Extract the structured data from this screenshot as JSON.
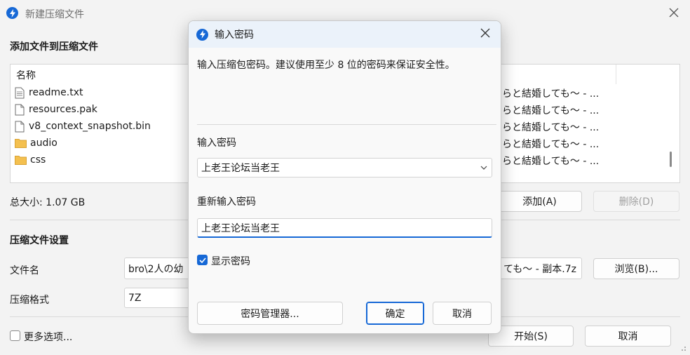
{
  "main_window": {
    "title": "新建压缩文件",
    "add_section_title": "添加文件到压缩文件",
    "file_list": {
      "header": "名称",
      "items": [
        {
          "name": "readme.txt",
          "type": "file",
          "right_text": "らと結婚しても～ - ..."
        },
        {
          "name": "resources.pak",
          "type": "file",
          "right_text": "らと結婚しても～ - ..."
        },
        {
          "name": "v8_context_snapshot.bin",
          "type": "file",
          "right_text": "らと結婚しても～ - ..."
        },
        {
          "name": "audio",
          "type": "folder",
          "right_text": "らと結婚しても～ - ..."
        },
        {
          "name": "css",
          "type": "folder",
          "right_text": "らと結婚しても～ - ..."
        }
      ]
    },
    "total_size": "总大小: 1.07 GB",
    "add_button": "添加(A)",
    "delete_button": "删除(D)",
    "settings_title": "压缩文件设置",
    "filename_label": "文件名",
    "filename_value_left": "bro\\2人の幼",
    "filename_value_right": "ても～ - 副本.7z",
    "browse_button": "浏览(B)...",
    "format_label": "压缩格式",
    "format_value": "7Z",
    "more_options": "更多选项...",
    "start_button": "开始(S)",
    "cancel_button": "取消"
  },
  "dialog": {
    "title": "输入密码",
    "instruction": "输入压缩包密码。建议使用至少 8 位的密码来保证安全性。",
    "password_label": "输入密码",
    "password_value": "上老王论坛当老王",
    "reenter_label": "重新输入密码",
    "reenter_value": "上老王论坛当老王",
    "show_password_label": "显示密码",
    "show_password_checked": true,
    "manager_button": "密码管理器...",
    "ok_button": "确定",
    "cancel_button": "取消"
  },
  "colors": {
    "accent": "#1668d6",
    "folder": "#f4c04f"
  }
}
